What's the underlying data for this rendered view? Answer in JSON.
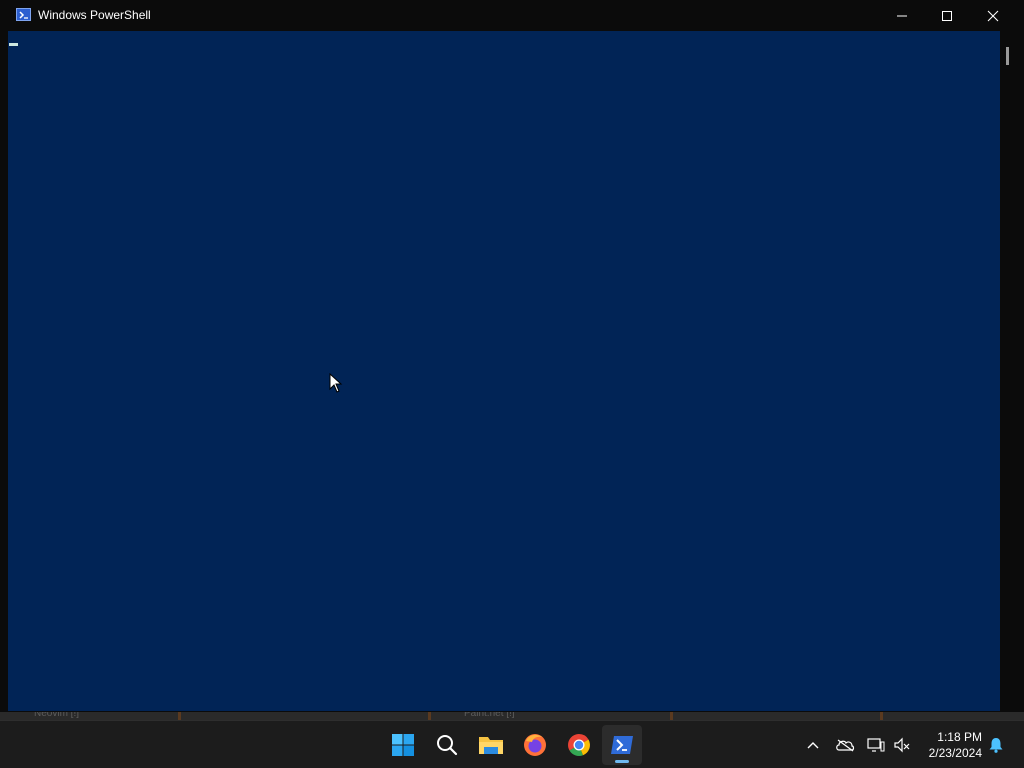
{
  "window": {
    "title": "Windows PowerShell",
    "console_background": "#012456",
    "controls": [
      "minimize-icon",
      "maximize-icon",
      "close-icon"
    ]
  },
  "background_windows": [
    "Neovim [!]",
    "Paint.net [!]"
  ],
  "taskbar": {
    "apps": [
      "start-icon",
      "search-icon",
      "file-explorer-icon",
      "firefox-icon",
      "chrome-icon",
      "powershell-icon"
    ],
    "active_app": "powershell-icon",
    "tray": [
      "chevron-up-icon",
      "onedrive-icon",
      "network-icon",
      "volume-muted-icon",
      "notification-bell-icon"
    ],
    "clock": {
      "time": "1:18 PM",
      "date": "2/23/2024"
    }
  }
}
